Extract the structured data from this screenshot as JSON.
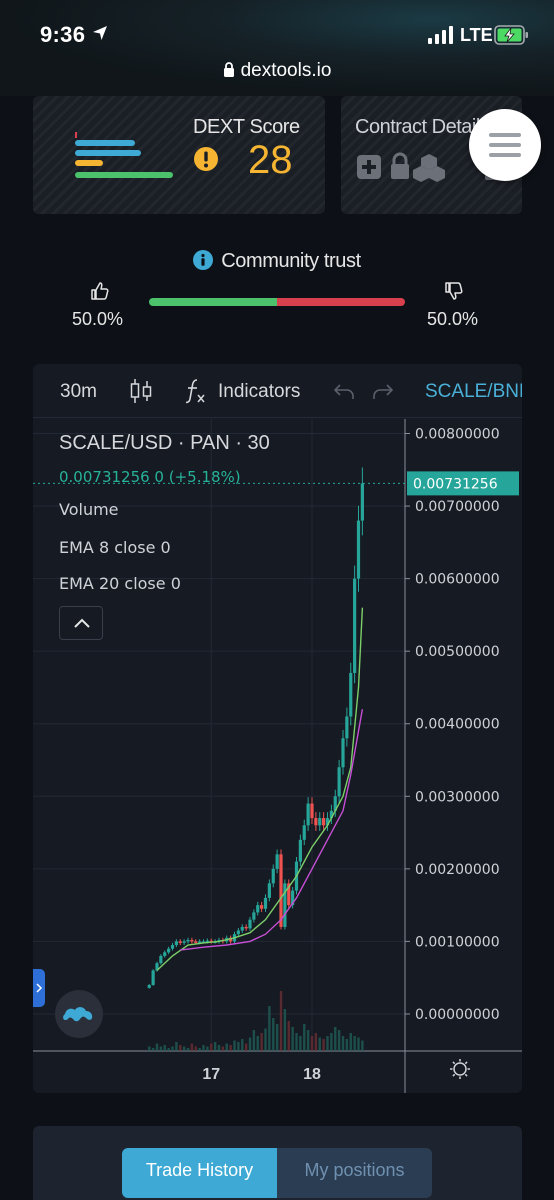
{
  "status_bar": {
    "time": "9:36",
    "network": "LTE",
    "url": "dextools.io",
    "icons": [
      "location-arrow-icon",
      "signal-bars-icon",
      "battery-charging-icon",
      "lock-icon"
    ]
  },
  "dext_card": {
    "title": "DEXT Score",
    "score": "28",
    "score_color": "#f5b532",
    "icon": "warning-icon"
  },
  "contract_card": {
    "title": "Contract Details",
    "icons": [
      "plus-shield-icon",
      "lock-icon",
      "cubes-icon",
      "document-icon"
    ]
  },
  "menu": {
    "icon": "hamburger-menu-icon"
  },
  "community": {
    "title": "Community trust",
    "positive_pct": "50.0%",
    "negative_pct": "50.0%",
    "positive_fraction": 0.5,
    "positive_color": "#4cc26c",
    "negative_color": "#d8404e"
  },
  "toolbar": {
    "interval": "30m",
    "indicators": "Indicators",
    "pair": "SCALE/BNB"
  },
  "legend": {
    "symbol": "SCALE/USD · PAN · 30",
    "price_line": "0.00731256  0 (+5.18%)",
    "volume": "Volume",
    "ema8": "EMA 8 close 0",
    "ema20": "EMA 20 close 0"
  },
  "chart_data": {
    "type": "candlestick",
    "title": "SCALE/USD · PAN · 30",
    "current_price": "0.00731256",
    "current_price_value": 0.00731256,
    "y_ticks": [
      "0.00800000",
      "0.00700000",
      "0.00600000",
      "0.00500000",
      "0.00400000",
      "0.00300000",
      "0.00200000",
      "0.00100000",
      "0.00000000"
    ],
    "y_tick_values": [
      0.008,
      0.007,
      0.006,
      0.005,
      0.004,
      0.003,
      0.002,
      0.001,
      0.0
    ],
    "ylim": [
      -0.0004,
      0.0082
    ],
    "x_ticks": [
      "17",
      "18"
    ],
    "x_tick_positions": [
      16.0,
      42.0
    ],
    "xlim": [
      -30,
      66
    ],
    "grid": true,
    "series": [
      {
        "name": "Price",
        "color": "#26a69a",
        "x": [
          0,
          1,
          2,
          3,
          4,
          5,
          6,
          7,
          8,
          9,
          10,
          11,
          12,
          13,
          14,
          15,
          16,
          17,
          18,
          19,
          20,
          21,
          22,
          23,
          24,
          25,
          26,
          27,
          28,
          29,
          30,
          31,
          32,
          33,
          34,
          35,
          36,
          37,
          38,
          39,
          40,
          41,
          42,
          43,
          44,
          45,
          46,
          47,
          48,
          49,
          50,
          51,
          52,
          53,
          54,
          55
        ],
        "values": [
          0.0004,
          0.0006,
          0.0007,
          0.0008,
          0.00085,
          0.0009,
          0.00095,
          0.001,
          0.00098,
          0.001,
          0.00102,
          0.001,
          0.00099,
          0.001,
          0.001,
          0.00101,
          0.001,
          0.001,
          0.00102,
          0.001,
          0.00105,
          0.001,
          0.0011,
          0.00115,
          0.0012,
          0.00118,
          0.0013,
          0.0014,
          0.0015,
          0.00145,
          0.0016,
          0.0018,
          0.002,
          0.0022,
          0.0012,
          0.0018,
          0.0015,
          0.0017,
          0.0021,
          0.0024,
          0.0026,
          0.0029,
          0.0027,
          0.0026,
          0.0027,
          0.0026,
          0.0027,
          0.0028,
          0.003,
          0.0034,
          0.0038,
          0.0041,
          0.0047,
          0.006,
          0.0068,
          0.00731256
        ]
      },
      {
        "name": "EMA 8",
        "color": "#7ccf6a",
        "x": [
          2,
          6,
          10,
          14,
          18,
          22,
          26,
          30,
          34,
          38,
          42,
          46,
          50,
          52,
          54,
          55
        ],
        "values": [
          0.0006,
          0.0008,
          0.00095,
          0.00098,
          0.001,
          0.00105,
          0.00112,
          0.0013,
          0.0016,
          0.0019,
          0.0023,
          0.0026,
          0.003,
          0.0034,
          0.0045,
          0.0056
        ]
      },
      {
        "name": "EMA 20",
        "color": "#c64fd6",
        "x": [
          8,
          14,
          20,
          26,
          30,
          34,
          38,
          42,
          46,
          50,
          52,
          54,
          55
        ],
        "values": [
          0.00088,
          0.00092,
          0.00095,
          0.001,
          0.0011,
          0.0013,
          0.0016,
          0.002,
          0.0024,
          0.0028,
          0.0033,
          0.0039,
          0.0042
        ]
      }
    ],
    "volume": [
      3,
      2,
      5,
      3,
      4,
      2,
      3,
      6,
      4,
      3,
      2,
      5,
      3,
      2,
      4,
      3,
      5,
      6,
      4,
      3,
      5,
      4,
      7,
      6,
      8,
      5,
      9,
      14,
      10,
      12,
      15,
      30,
      22,
      18,
      40,
      28,
      20,
      16,
      12,
      10,
      18,
      14,
      10,
      12,
      9,
      8,
      10,
      12,
      16,
      14,
      10,
      8,
      12,
      10,
      9,
      7
    ]
  },
  "bottom_tabs": {
    "trade_history": "Trade History",
    "my_positions": "My positions"
  }
}
